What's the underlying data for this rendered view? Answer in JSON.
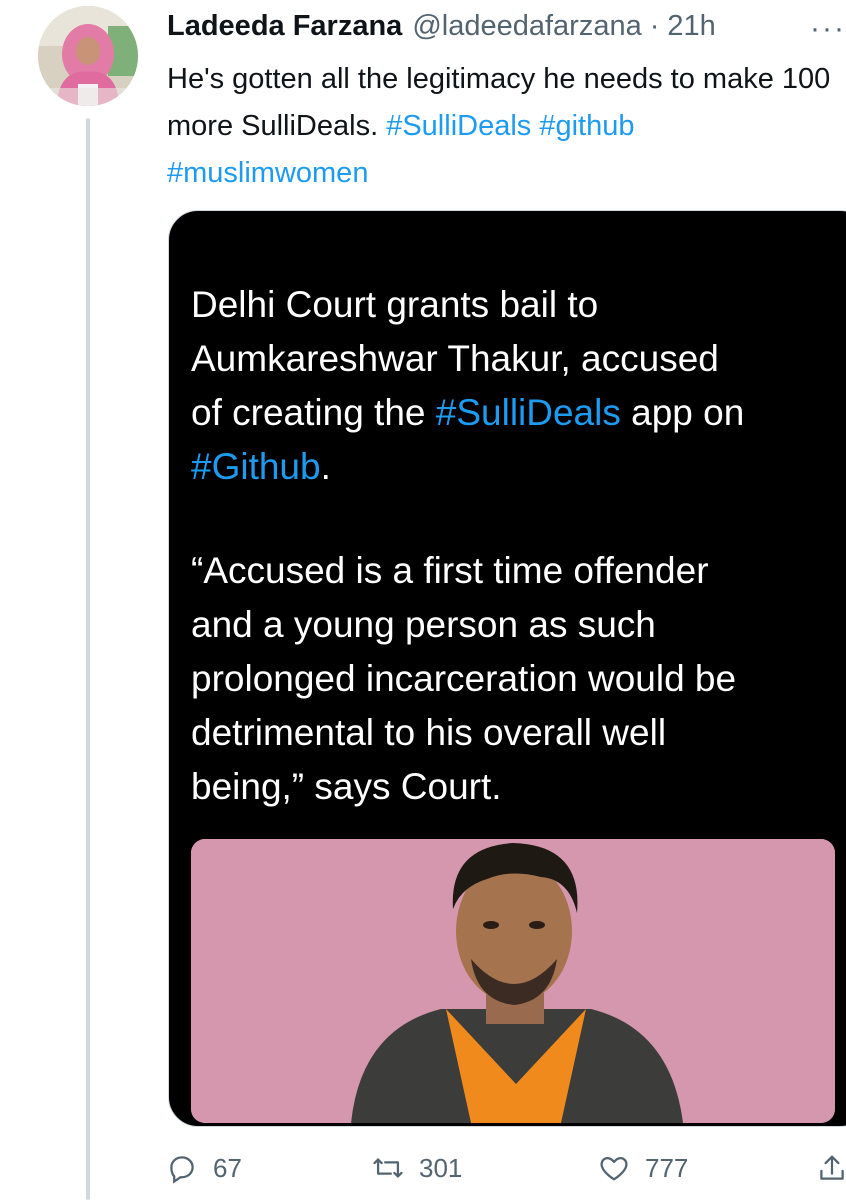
{
  "tweet": {
    "author_name": "Ladeeda Farzana",
    "handle": "@ladeedafarzana",
    "separator": "·",
    "time": "21h",
    "more": "···",
    "text_plain": "He's gotten all the legitimacy he needs to make 100 more SulliDeals.",
    "hashtags": [
      "#SulliDeals",
      "#github",
      "#muslimwomen"
    ]
  },
  "media_card": {
    "line1": "Delhi Court grants bail to",
    "line2": "Aumkareshwar Thakur, accused",
    "line3_pre": "of creating the ",
    "line3_tag": "#SulliDeals",
    "line3_post": " app on",
    "line4_tag": "#Github",
    "line4_post": ".",
    "quote_lines": [
      "“Accused is a first time offender",
      "and a young person as such",
      "prolonged incarceration would be",
      "detrimental to his overall well",
      "being,” says Court."
    ]
  },
  "actions": {
    "reply_count": "67",
    "retweet_count": "301",
    "like_count": "777"
  },
  "icons": [
    "reply-icon",
    "retweet-icon",
    "like-icon",
    "share-icon",
    "more-icon"
  ],
  "colors": {
    "link": "#1d9bf0",
    "muted": "#536471",
    "text": "#0f1419"
  }
}
